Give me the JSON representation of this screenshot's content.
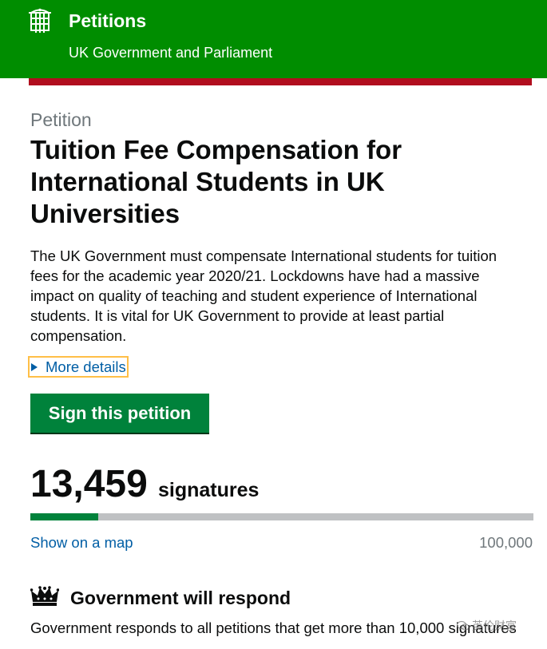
{
  "header": {
    "title": "Petitions",
    "subtitle": "UK Government and Parliament",
    "logo_icon": "portcullis-icon",
    "background_color": "#008d00",
    "accent_bar_color": "#b10e1e"
  },
  "petition": {
    "caption": "Petition",
    "title": "Tuition Fee Compensation for International Students in UK Universities",
    "summary": "The UK Government must compensate International students for tuition fees for the academic year 2020/21. Lockdowns have had a massive impact on quality of teaching and student experience of International students. It is vital for UK Government to provide at least partial compensation.",
    "more_details_label": "More details",
    "sign_button_label": "Sign this petition"
  },
  "signatures": {
    "count_text": "13,459",
    "label": "signatures",
    "count": 13459,
    "threshold": 100000,
    "threshold_text": "100,000",
    "map_link_label": "Show on a map"
  },
  "government_response": {
    "icon": "crown-icon",
    "heading": "Government will respond",
    "text": "Government responds to all petitions that get more than 10,000 signatures"
  },
  "colors": {
    "link": "#005ea5",
    "button": "#00823b",
    "progress_track": "#bfc1c3",
    "focus_outline": "#ffbf47"
  },
  "watermark": {
    "text": "英伦财富",
    "icon": "wechat-icon"
  }
}
